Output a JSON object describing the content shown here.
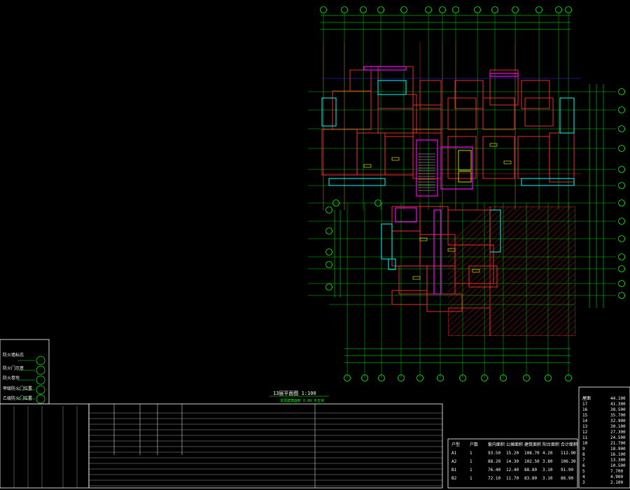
{
  "drawing": {
    "title": "13层平面图 1:100",
    "subtitle": "本层建筑面积 0.00 平方米"
  },
  "legend": {
    "items": [
      "防火墙标志",
      "防火门示意",
      "防火卷帘",
      "甲级防火门位置",
      "乙级防火门位置"
    ]
  },
  "level_table": {
    "rows": [
      [
        "屋面",
        "44.100"
      ],
      [
        "17",
        "41.300"
      ],
      [
        "16",
        "38.500"
      ],
      [
        "15",
        "35.700"
      ],
      [
        "14",
        "32.900"
      ],
      [
        "13",
        "30.100"
      ],
      [
        "12",
        "27.300"
      ],
      [
        "11",
        "24.500"
      ],
      [
        "10",
        "21.700"
      ],
      [
        "9",
        "18.900"
      ],
      [
        "8",
        "16.100"
      ],
      [
        "7",
        "13.300"
      ],
      [
        "6",
        "10.500"
      ],
      [
        "5",
        "7.700"
      ],
      [
        "4",
        "4.900"
      ],
      [
        "3",
        "2.100"
      ]
    ]
  },
  "area_table": {
    "headers": [
      "户型",
      "户数",
      "套内面积",
      "公摊面积",
      "建筑面积",
      "阳台面积",
      "合计面积"
    ],
    "rows": [
      [
        "A1",
        "1",
        "93.50",
        "15.20",
        "108.70",
        "4.20",
        "112.90"
      ],
      [
        "A2",
        "1",
        "88.20",
        "14.30",
        "102.50",
        "3.80",
        "106.30"
      ],
      [
        "B1",
        "1",
        "76.40",
        "12.40",
        "88.80",
        "3.10",
        "91.90"
      ],
      [
        "B2",
        "1",
        "72.10",
        "11.70",
        "83.80",
        "3.10",
        "86.90"
      ]
    ]
  },
  "colors": {
    "grid": "#00ff00",
    "wall": "#ff00ff",
    "wall2": "#ff3030",
    "cyan": "#00ffff",
    "yellow": "#ffff00",
    "blue": "#3030ff",
    "white": "#ffffff",
    "orange": "#ff8000"
  }
}
